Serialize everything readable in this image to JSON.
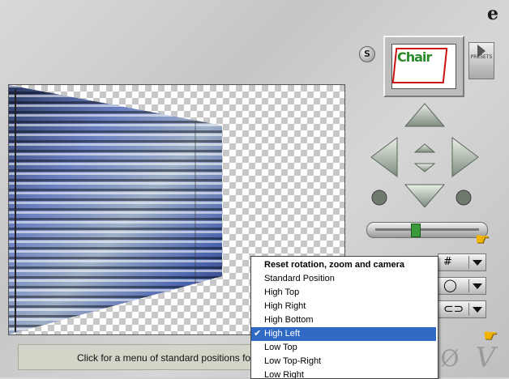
{
  "logo": {
    "glyph": "e"
  },
  "s_button": {
    "label": "S"
  },
  "preview": {
    "title": "Chair"
  },
  "presets": {
    "label": "PRESETS"
  },
  "status": {
    "text": "Click for a menu of standard positions for the"
  },
  "buttons": {
    "cancel_glyph": "Ø",
    "ok_glyph": "V"
  },
  "zoom": {
    "value_fraction": 0.38
  },
  "menu": {
    "items": [
      {
        "label": "Reset rotation, zoom and camera",
        "bold": true,
        "selected": false
      },
      {
        "label": "Standard Position",
        "bold": false,
        "selected": false
      },
      {
        "label": "High Top",
        "bold": false,
        "selected": false
      },
      {
        "label": "High Right",
        "bold": false,
        "selected": false
      },
      {
        "label": "High Bottom",
        "bold": false,
        "selected": false
      },
      {
        "label": "High Left",
        "bold": false,
        "selected": true
      },
      {
        "label": "Low Top",
        "bold": false,
        "selected": false
      },
      {
        "label": "Low Top-Right",
        "bold": false,
        "selected": false
      },
      {
        "label": "Low Right",
        "bold": false,
        "selected": false
      }
    ]
  },
  "colors": {
    "selection": "#316ac5",
    "blind_blue": "#4a5f9c",
    "hand": "#f2b400"
  }
}
